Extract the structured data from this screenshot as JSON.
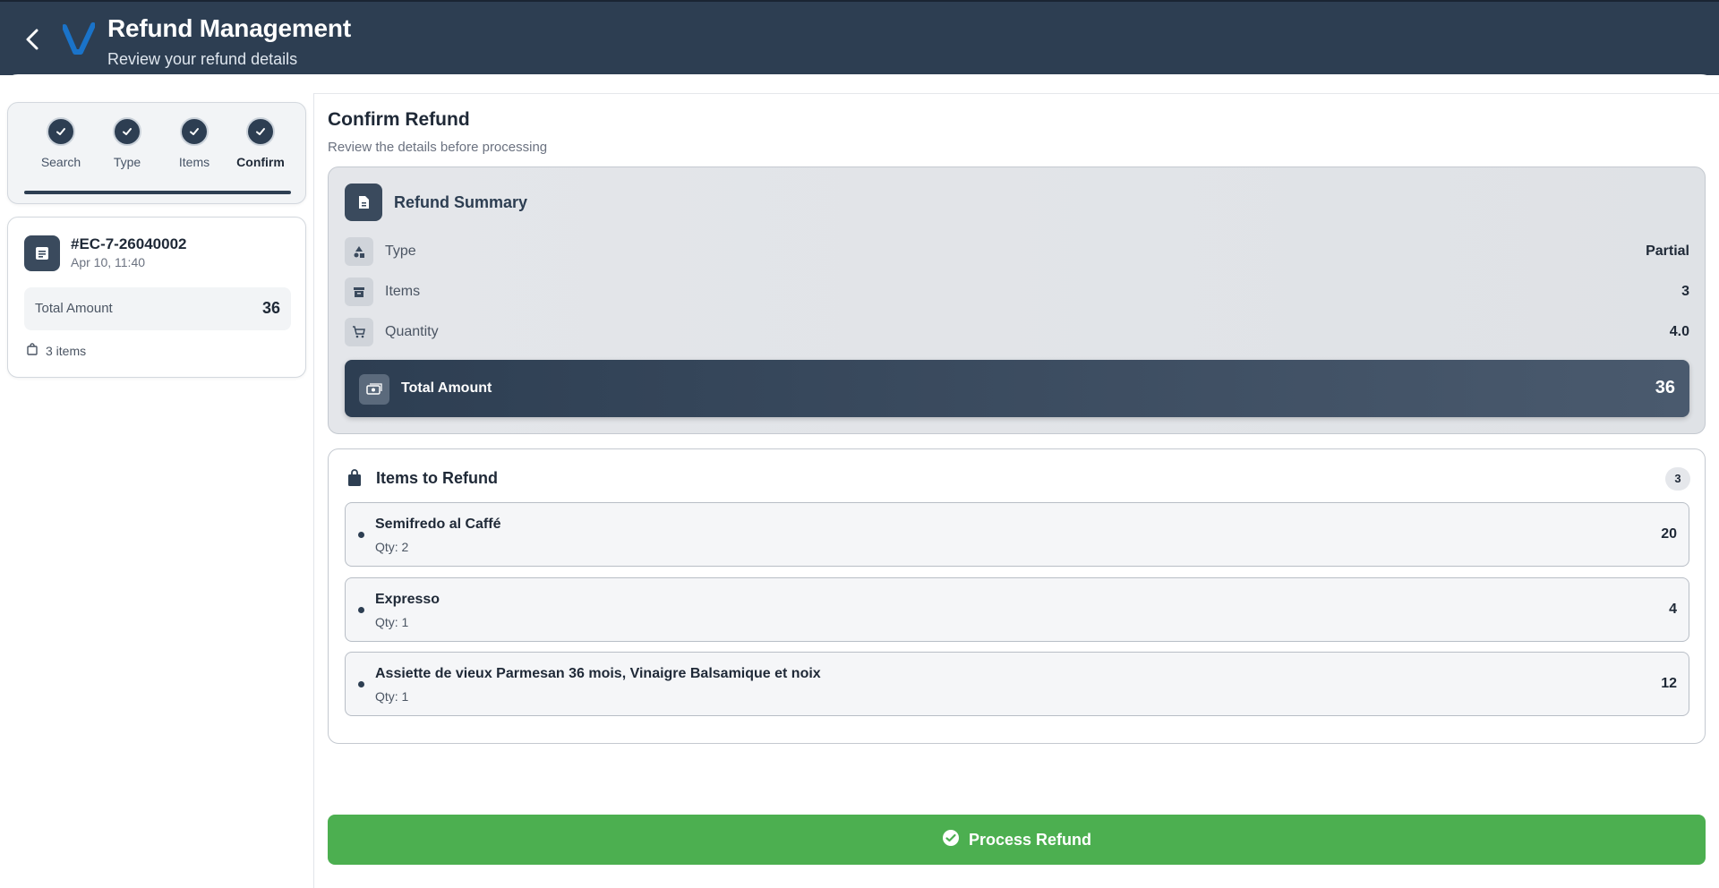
{
  "header": {
    "title": "Refund Management",
    "subtitle": "Review your refund details"
  },
  "steps": [
    {
      "label": "Search",
      "state": "done"
    },
    {
      "label": "Type",
      "state": "done"
    },
    {
      "label": "Items",
      "state": "done"
    },
    {
      "label": "Confirm",
      "state": "active"
    }
  ],
  "order": {
    "id": "#EC-7-26040002",
    "date": "Apr 10, 11:40",
    "total_label": "Total Amount",
    "total_value": "36",
    "items_text": "3 items"
  },
  "confirm": {
    "title": "Confirm Refund",
    "subtitle": "Review the details before processing"
  },
  "summary": {
    "title": "Refund Summary",
    "rows": [
      {
        "label": "Type",
        "value": "Partial",
        "icon": "shapes-icon"
      },
      {
        "label": "Items",
        "value": "3",
        "icon": "archive-icon"
      },
      {
        "label": "Quantity",
        "value": "4.0",
        "icon": "cart-icon"
      }
    ],
    "total_label": "Total Amount",
    "total_value": "36"
  },
  "items_section": {
    "title": "Items to Refund",
    "count": "3",
    "items": [
      {
        "name": "Semifredo al Caffé",
        "qty": "Qty: 2",
        "price": "20"
      },
      {
        "name": "Expresso",
        "qty": "Qty: 1",
        "price": "4"
      },
      {
        "name": "Assiette de vieux Parmesan 36 mois, Vinaigre Balsamique et noix",
        "qty": "Qty: 1",
        "price": "12"
      }
    ]
  },
  "process_button": "Process Refund",
  "colors": {
    "header_bg": "#2d3e52",
    "accent": "#2d3e52",
    "logo_blue": "#1a73c9",
    "success": "#4caf50"
  }
}
